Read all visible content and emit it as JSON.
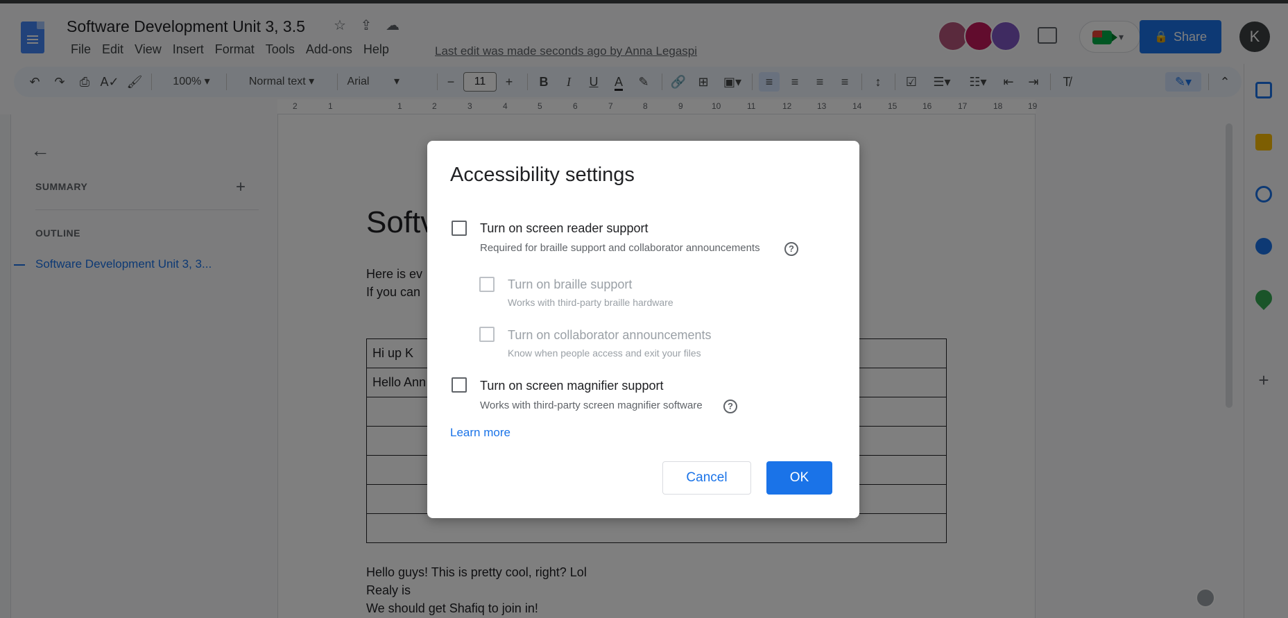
{
  "header": {
    "doc_title": "Software Development Unit 3, 3.5",
    "menu": [
      "File",
      "Edit",
      "View",
      "Insert",
      "Format",
      "Tools",
      "Add-ons",
      "Help"
    ],
    "last_edit": "Last edit was made seconds ago by Anna Legaspi",
    "share_label": "Share",
    "user_initial": "K",
    "star_icon": "☆",
    "move_icon": "⇪",
    "cloud_icon": "☁"
  },
  "toolbar": {
    "zoom": "100%",
    "style": "Normal text",
    "font": "Arial",
    "font_size": "11"
  },
  "ruler": {
    "ticks": [
      "2",
      "1",
      "1",
      "2",
      "3",
      "4",
      "5",
      "6",
      "7",
      "8",
      "9",
      "10",
      "11",
      "12",
      "13",
      "14",
      "15",
      "16",
      "17",
      "18",
      "19"
    ]
  },
  "outline": {
    "summary_label": "SUMMARY",
    "outline_label": "OUTLINE",
    "item": "Software Development Unit 3, 3..."
  },
  "document": {
    "title_visible": "Softv",
    "line1": "Here is ev",
    "line2": "If you can",
    "table_row1": "Hi up    K",
    "table_row2": "Hello Ann",
    "para1": "Hello guys! This is pretty cool, right? Lol",
    "para2": "Realy is",
    "para3": "We should get Shafiq to join in!"
  },
  "dialog": {
    "title": "Accessibility settings",
    "screen_reader_label": "Turn on screen reader support",
    "screen_reader_desc": "Required for braille support and collaborator announcements",
    "braille_label": "Turn on braille support",
    "braille_desc": "Works with third-party braille hardware",
    "collab_label": "Turn on collaborator announcements",
    "collab_desc": "Know when people access and exit your files",
    "magnifier_label": "Turn on screen magnifier support",
    "magnifier_desc": "Works with third-party screen magnifier software",
    "learn_more": "Learn more",
    "cancel": "Cancel",
    "ok": "OK"
  },
  "colors": {
    "accent": "#1a73e8",
    "overlay": "rgba(0,0,0,0.5)"
  }
}
